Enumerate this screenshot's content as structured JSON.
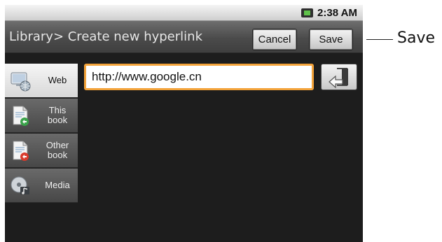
{
  "status": {
    "time": "2:38 AM"
  },
  "header": {
    "title": "Library> Create new hyperlink",
    "cancel_label": "Cancel",
    "save_label": "Save"
  },
  "tabs": [
    {
      "label": "Web",
      "icon": "web-icon",
      "active": true
    },
    {
      "label": "This book",
      "icon": "this-book-icon",
      "active": false
    },
    {
      "label": "Other book",
      "icon": "other-book-icon",
      "active": false
    },
    {
      "label": "Media",
      "icon": "media-icon",
      "active": false
    }
  ],
  "url_input": {
    "value": "http://www.google.cn"
  },
  "callout": {
    "text": "Save"
  },
  "colors": {
    "input_border": "#f3a33a",
    "battery": "#5fc24a"
  }
}
